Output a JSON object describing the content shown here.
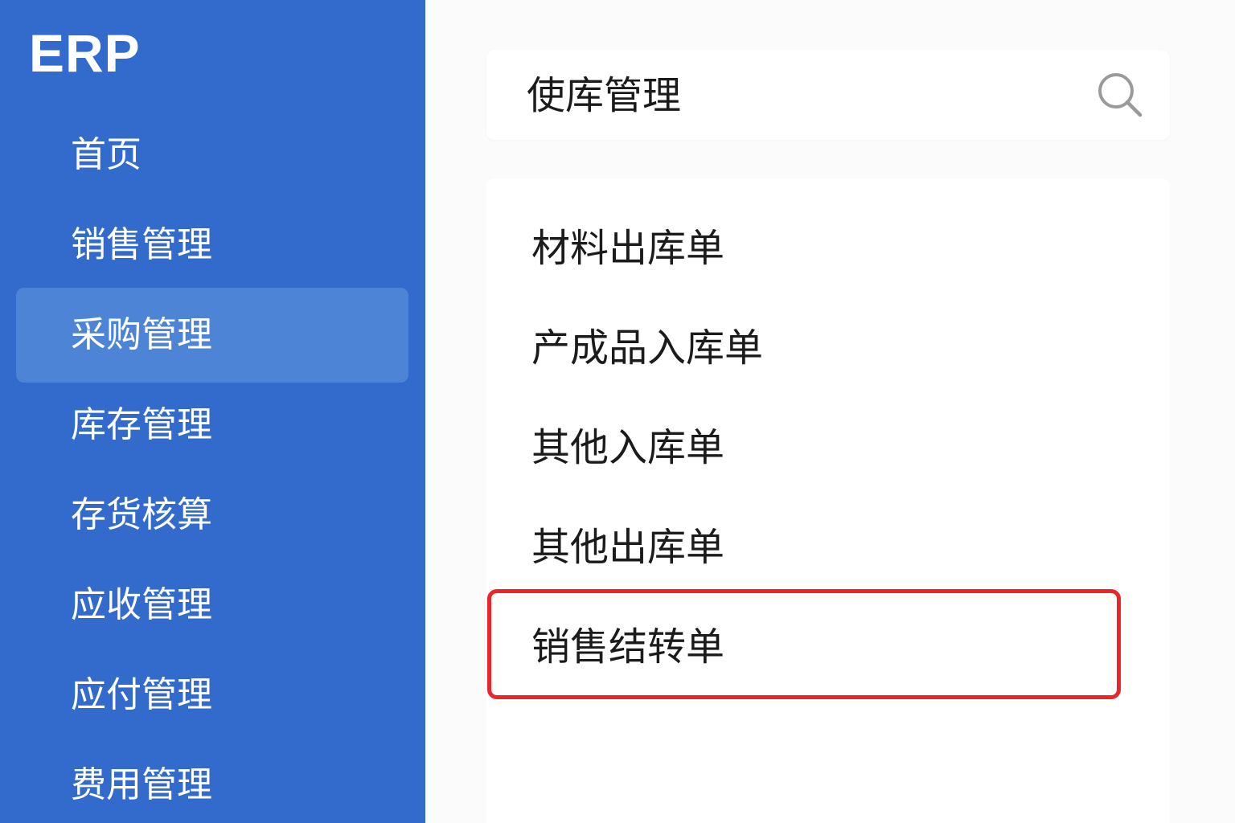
{
  "app": {
    "logo": "ERP"
  },
  "sidebar": {
    "items": [
      {
        "label": "首页",
        "active": false
      },
      {
        "label": "销售管理",
        "active": false
      },
      {
        "label": "采购管理",
        "active": true
      },
      {
        "label": "库存管理",
        "active": false
      },
      {
        "label": "存货核算",
        "active": false
      },
      {
        "label": "应收管理",
        "active": false
      },
      {
        "label": "应付管理",
        "active": false
      },
      {
        "label": "费用管理",
        "active": false
      }
    ]
  },
  "search": {
    "value": "使库管理",
    "icon": "search-icon"
  },
  "menu": {
    "items": [
      {
        "label": "材料出库单"
      },
      {
        "label": "产成品入库单"
      },
      {
        "label": "其他入库单"
      },
      {
        "label": "其他出库单"
      },
      {
        "label": "销售结转单",
        "highlighted": true
      }
    ]
  },
  "colors": {
    "sidebar_bg": "#326bcb",
    "sidebar_active_bg": "#4e84d6",
    "highlight_border": "#e8262b",
    "text_dark": "#1b1b1b",
    "page_bg": "#fbfbfb"
  }
}
